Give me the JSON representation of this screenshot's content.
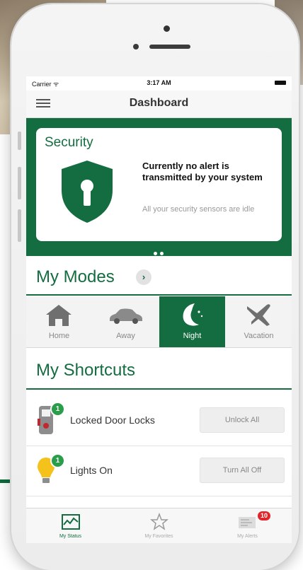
{
  "status_bar": {
    "carrier": "Carrier ᯤ",
    "time": "3:17 AM"
  },
  "navbar": {
    "title": "Dashboard"
  },
  "security": {
    "title": "Security",
    "headline": "Currently no alert is transmitted by your system",
    "subtext": "All your security sensors are idle",
    "page_dots": 2
  },
  "modes": {
    "title": "My Modes",
    "chevron": "›",
    "items": [
      {
        "label": "Home",
        "icon": "home-icon",
        "active": false
      },
      {
        "label": "Away",
        "icon": "car-icon",
        "active": false
      },
      {
        "label": "Night",
        "icon": "moon-icon",
        "active": true
      },
      {
        "label": "Vacation",
        "icon": "airplane-icon",
        "active": false
      }
    ]
  },
  "shortcuts": {
    "title": "My Shortcuts",
    "items": [
      {
        "label": "Locked Door Locks",
        "button": "Unlock All",
        "badge": "1",
        "icon": "door-lock-icon"
      },
      {
        "label": "Lights On",
        "button": "Turn All Off",
        "badge": "1",
        "icon": "light-bulb-icon"
      }
    ]
  },
  "tabbar": {
    "items": [
      {
        "label": "My Status",
        "icon": "status-chart-icon",
        "active": true
      },
      {
        "label": "My Favorites",
        "icon": "star-icon",
        "active": false
      },
      {
        "label": "My Alerts",
        "icon": "alerts-icon",
        "active": false,
        "badge": "10"
      }
    ]
  },
  "colors": {
    "brand_green": "#146d40",
    "badge_green": "#2a9d4a",
    "alert_red": "#e0262b",
    "bulb_yellow": "#f5c21b"
  }
}
